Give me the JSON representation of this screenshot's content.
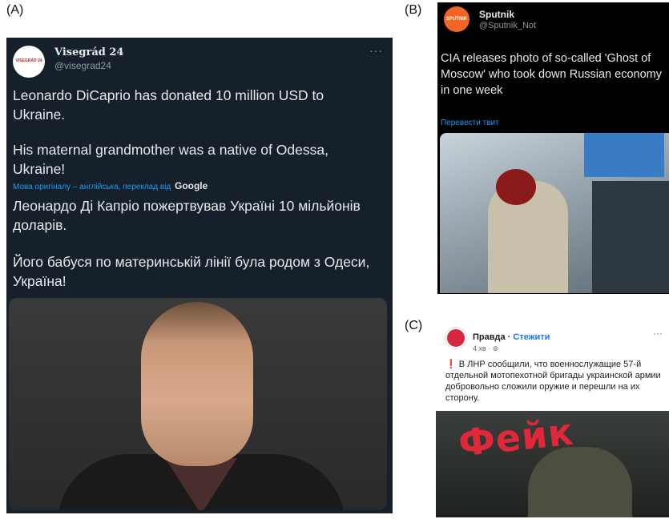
{
  "labels": {
    "a": "(A)",
    "b": "(B)",
    "c": "(C)"
  },
  "panel_a": {
    "avatar_text": "VISEGRÁD 24",
    "account_name": "Visegrád 24",
    "handle": "@visegrad24",
    "more": "···",
    "text_1": "Leonardo DiCaprio has donated 10 million USD to Ukraine.",
    "text_2": "His maternal grandmother was a native of Odessa, Ukraine!",
    "translate_note": "Мова оригіналу – англійська, переклад від",
    "translate_provider": "Google",
    "translated_1": "Леонардо Ді Капріо пожертвував Україні 10 мільйонів доларів.",
    "translated_2": "Його бабуся по материнській лінії була родом з Одеси, Україна!"
  },
  "panel_b": {
    "avatar_text": "SPUTNIK",
    "account_name": "Sputnik",
    "handle": "@Sputnik_Not",
    "text": "CIA releases photo of so-called 'Ghost of Moscow' who took down Russian economy in one week",
    "translate_link": "Перевести твит"
  },
  "panel_c": {
    "page_name": "Правда",
    "follow": "Стежити",
    "time": "4 хв · ",
    "exclaim": "❗",
    "text": "В ЛНР сообщили, что военнослужащие 57-й отдельной мотопехотной бригады украинской армии добровольно сложили оружие и перешли на их сторону.",
    "stamp": "Фейк",
    "more": "···"
  }
}
